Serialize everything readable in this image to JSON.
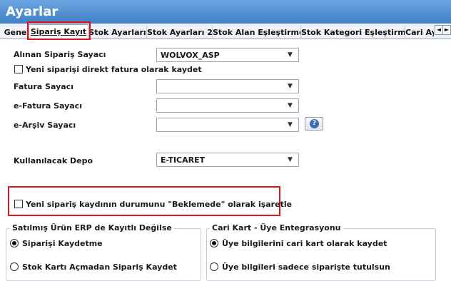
{
  "window": {
    "title": "Ayarlar"
  },
  "tabs": [
    {
      "label": "Gene"
    },
    {
      "label": "Sipariş Kayıt"
    },
    {
      "label": "Stok Ayarları"
    },
    {
      "label": "Stok Ayarları 2"
    },
    {
      "label": "Stok Alan Eşleştirme"
    },
    {
      "label": "Stok Kategori Eşleştirme"
    },
    {
      "label": "Cari Ay"
    }
  ],
  "tab_nav": {
    "prev": "◄",
    "next": "►"
  },
  "form": {
    "order_counter_label": "Alınan Sipariş Sayacı",
    "order_counter_value": "WOLVOX_ASP",
    "save_as_invoice_label": "Yeni siparişi direkt fatura olarak kaydet",
    "invoice_counter_label": "Fatura Sayacı",
    "invoice_counter_value": "",
    "efatura_counter_label": "e-Fatura Sayacı",
    "efatura_counter_value": "",
    "earsiv_counter_label": "e-Arşiv Sayacı",
    "earsiv_counter_value": "",
    "warehouse_label": "Kullanılacak Depo",
    "warehouse_value": "E-TICARET",
    "pending_status_label": "Yeni sipariş kaydının durumunu \"Beklemede\" olarak işaretle",
    "dropdown_arrow": "▼",
    "help_glyph": "?"
  },
  "group_erp": {
    "title": "Satılmış Ürün ERP de Kayıtlı Değilse",
    "options": [
      {
        "label": "Siparişi Kaydetme",
        "checked": true
      },
      {
        "label": "Stok Kartı Açmadan Sipariş Kaydet",
        "checked": false
      }
    ]
  },
  "group_cari": {
    "title": "Cari Kart - Üye Entegrasyonu",
    "options": [
      {
        "label": "Üye bilgilerini cari kart olarak kaydet",
        "checked": true
      },
      {
        "label": "Üye bilgileri sadece siparişte tutulsun",
        "checked": false
      }
    ]
  },
  "colors": {
    "title_bar": "#4f8fd3",
    "highlight": "#e0141b"
  }
}
